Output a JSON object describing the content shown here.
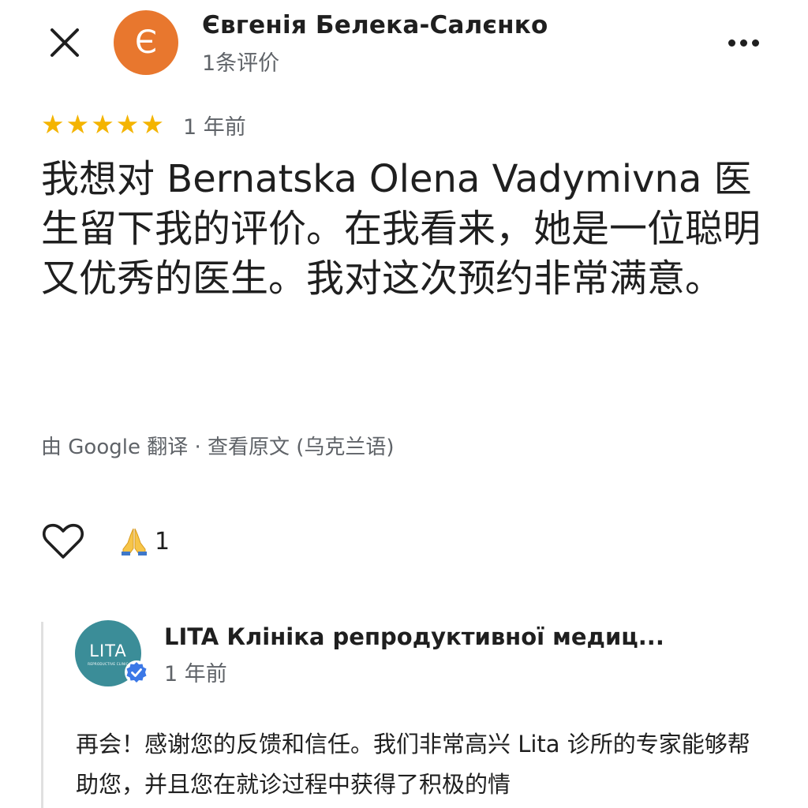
{
  "header": {
    "close_icon": "close-icon",
    "avatar_letter": "Є",
    "avatar_color": "#e8772e",
    "reviewer_name": "Євгенія Белека-Салєнко",
    "review_count": "1条评价",
    "more_icon": "more-horizontal-icon"
  },
  "review": {
    "rating": 5,
    "max_rating": 5,
    "stars": [
      "★",
      "★",
      "★",
      "★",
      "★"
    ],
    "star_color": "#f4b400",
    "time": "1 年前",
    "text": "我想对 Bernatska Olena Vadymivna 医生留下我的评价。在我看来，她是一位聪明又优秀的医生。我对这次预约非常满意。",
    "translation_prefix": "由 Google 翻译 · ",
    "view_original": "查看原文 (乌克兰语)"
  },
  "actions": {
    "like_icon": "heart-outline-icon",
    "reaction_emoji": "🙏",
    "reaction_count": "1"
  },
  "owner_reply": {
    "avatar_text": "LITA",
    "avatar_subtext": "REPRODUCTIVE CLINIC",
    "avatar_color": "#3b8d98",
    "verified_icon": "verified-badge-icon",
    "name": "LITA Клініка репродуктивної медиц...",
    "time": "1 年前",
    "text": "再会！感谢您的反馈和信任。我们非常高兴 Lita 诊所的专家能够帮助您，并且您在就诊过程中获得了积极的情"
  }
}
